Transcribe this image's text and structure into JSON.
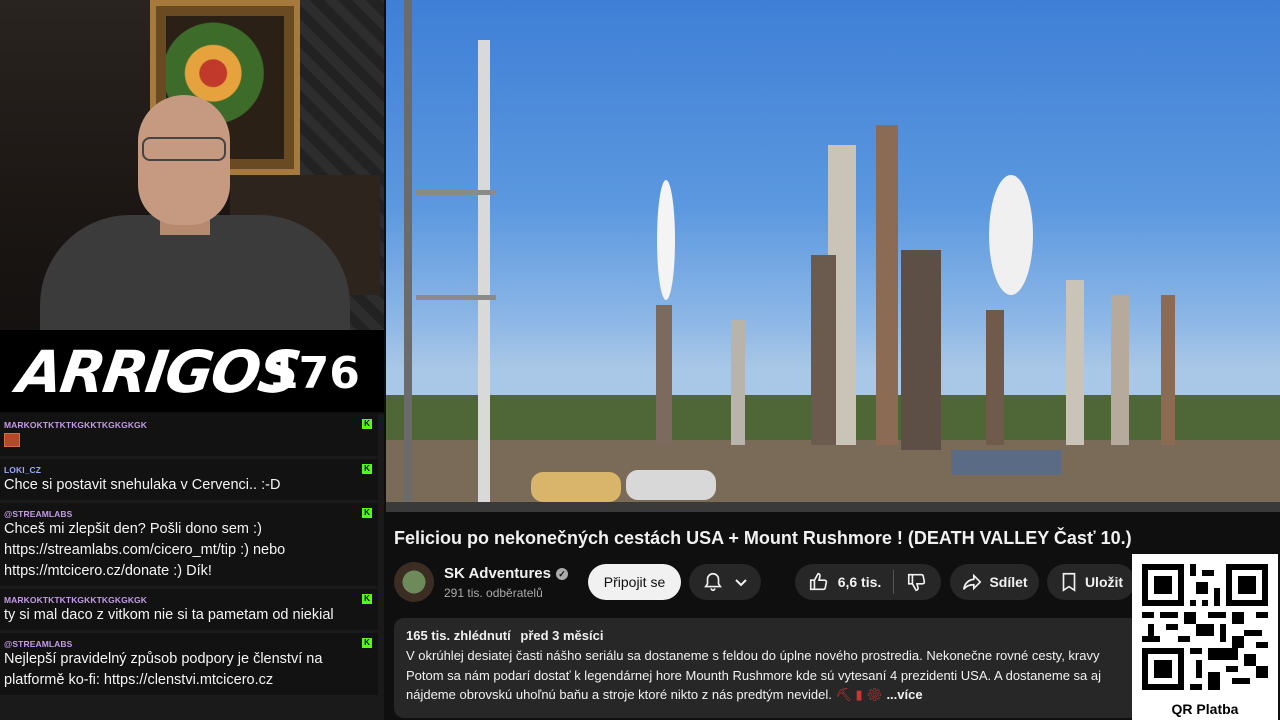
{
  "stream": {
    "banner_name": "ARRIGOS",
    "banner_number": "176"
  },
  "chat": [
    {
      "user": "MARKOKTKTKTKGKKTKGKGKGK",
      "user_color": "#c49be8",
      "text": "",
      "emote": true
    },
    {
      "user": "LOKI_CZ",
      "user_color": "#9aa7ff",
      "text": "Chce si postavit snehulaka v Cervenci.. :-D",
      "emote": false
    },
    {
      "user": "@STREAMLABS",
      "user_color": "#c49be8",
      "text": "Chceš mi zlepšit den? Pošli dono sem :) https://streamlabs.com/cicero_mt/tip :) nebo https://mtcicero.cz/donate :) Dík!",
      "emote": false
    },
    {
      "user": "MARKOKTKTKTKGKKTKGKGKGK",
      "user_color": "#c49be8",
      "text": "ty si mal daco z vitkom nie si ta pametam od niekial",
      "emote": false
    },
    {
      "user": "@STREAMLABS",
      "user_color": "#c49be8",
      "text": "Nejlepší pravidelný způsob podpory je členství na platformě ko-fi: https://clenstvi.mtcicero.cz",
      "emote": false
    }
  ],
  "video": {
    "title": "Feliciou po nekonečných cestách USA + Mount Rushmore ! (DEATH VALLEY Časť 10.)",
    "channel_name": "SK Adventures",
    "subscribers": "291 tis. odběratelů",
    "subscribe_label": "Připojit se",
    "likes": "6,6 tis.",
    "share_label": "Sdílet",
    "save_label": "Uložit",
    "views": "165 tis. zhlédnutí",
    "age": "před 3 měsíci",
    "description_lines": [
      "V okrúhlej desiatej časti nášho seriálu sa dostaneme s feldou do úplne nového prostredia. Nekonečne rovné cesty, kravy",
      "Potom sa nám podarí dostať k legendárnej hore Mounth Rushmore kde sú vytesaní 4 prezidenti USA. A dostaneme sa aj",
      "nájdeme obrovskú uhoľnú baňu a stroje ktoré nikto z nás predtým nevidel. "
    ],
    "more_label": "...více"
  },
  "qr": {
    "label": "QR Platba"
  },
  "icons": {
    "bell": "bell-icon",
    "like": "thumbs-up-icon",
    "dislike": "thumbs-down-icon",
    "share": "share-icon",
    "save": "bookmark-icon"
  },
  "colors": {
    "kick_green": "#53fc18",
    "background": "#0f0f0f",
    "button": "#272727"
  }
}
